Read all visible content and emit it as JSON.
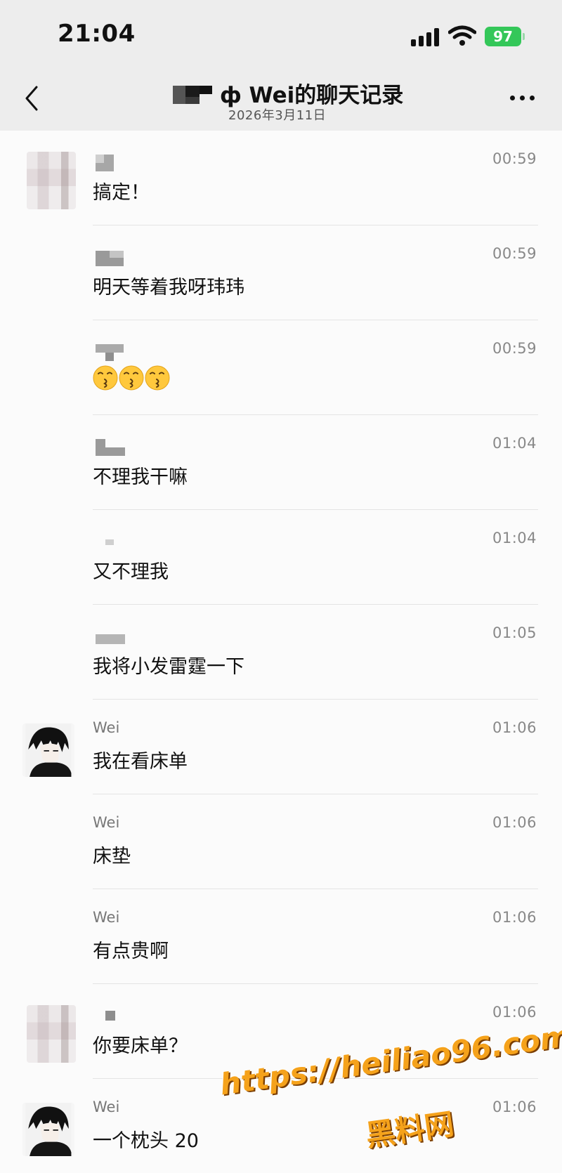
{
  "status_bar": {
    "time": "21:04",
    "battery": "97"
  },
  "nav": {
    "title": "ф Wei的聊天记录",
    "subtitle": "2026年3月11日"
  },
  "messages": [
    {
      "sender": "",
      "time": "00:59",
      "text": "搞定！"
    },
    {
      "sender": "",
      "time": "00:59",
      "text": "明天等着我呀玮玮"
    },
    {
      "sender": "",
      "time": "00:59",
      "text": "😙😙😙"
    },
    {
      "sender": "",
      "time": "01:04",
      "text": "不理我干嘛"
    },
    {
      "sender": "",
      "time": "01:04",
      "text": "又不理我"
    },
    {
      "sender": "",
      "time": "01:05",
      "text": "我将小发雷霆一下"
    },
    {
      "sender": "Wei",
      "time": "01:06",
      "text": "我在看床单"
    },
    {
      "sender": "Wei",
      "time": "01:06",
      "text": "床垫"
    },
    {
      "sender": "Wei",
      "time": "01:06",
      "text": "有点贵啊"
    },
    {
      "sender": "",
      "time": "01:06",
      "text": "你要床单？"
    },
    {
      "sender": "Wei",
      "time": "01:06",
      "text": "一个枕头 20"
    }
  ],
  "watermark": {
    "url": "https://heiliao96.com",
    "name": "黑料网"
  }
}
